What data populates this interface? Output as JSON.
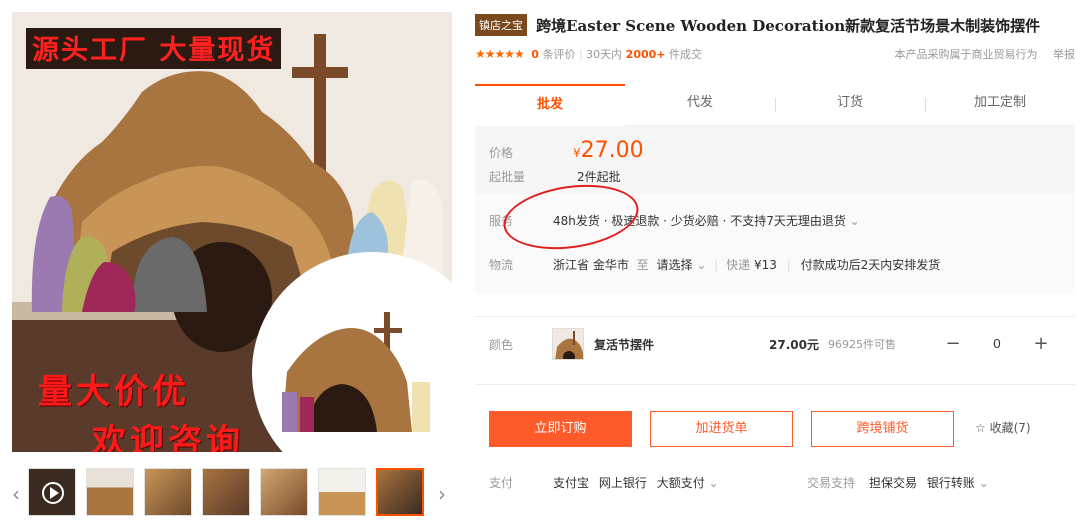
{
  "gallery": {
    "banner": "源头工厂 大量现货",
    "promo_line1": "量大价优",
    "promo_line2": "欢迎咨询",
    "prev_arrow": "‹",
    "next_arrow": "›"
  },
  "product": {
    "shop_tag": "镇店之宝",
    "title": "跨境Easter Scene Wooden Decoration新款复活节场景木制装饰摆件",
    "rating_stars": "★★★★★",
    "review_count": "0",
    "review_label": "条评价",
    "sold_prefix": "30天内",
    "sold_count": "2000+",
    "sold_suffix": "件成交",
    "right_note": "本产品采购属于商业贸易行为",
    "right_link": "举报"
  },
  "tabs": [
    "批发",
    "代发",
    "订货",
    "加工定制"
  ],
  "price": {
    "price_label": "价格",
    "currency": "¥",
    "amount": "27.00",
    "moq_label": "起批量",
    "moq_value": "2件起批"
  },
  "service": {
    "service_label": "服务",
    "service_value": "48h发货 · 极速退款 · 少货必赔 · 不支持7天无理由退货",
    "logistics_label": "物流",
    "origin": "浙江省 金华市",
    "to": "至",
    "dest": "请选择",
    "express_label": "快递",
    "express_fee": "¥13",
    "ship_note": "付款成功后2天内安排发货"
  },
  "sku": {
    "color_label": "颜色",
    "option_name": "复活节摆件",
    "option_price": "27.00元",
    "stock": "96925件可售",
    "minus": "−",
    "quantity": "0",
    "plus": "+"
  },
  "actions": {
    "order": "立即订购",
    "add_cart": "加进货单",
    "cross_border": "跨境铺货",
    "favorite": "收藏(7)"
  },
  "payment": {
    "pay_label": "支付",
    "methods": [
      "支付宝",
      "网上银行",
      "大额支付"
    ],
    "trade_label": "交易支持",
    "trade_methods": [
      "担保交易",
      "银行转账"
    ]
  },
  "colors": {
    "accent": "#ff5000",
    "button": "#ff5a2a",
    "shop_tag": "#7a4a1e"
  }
}
